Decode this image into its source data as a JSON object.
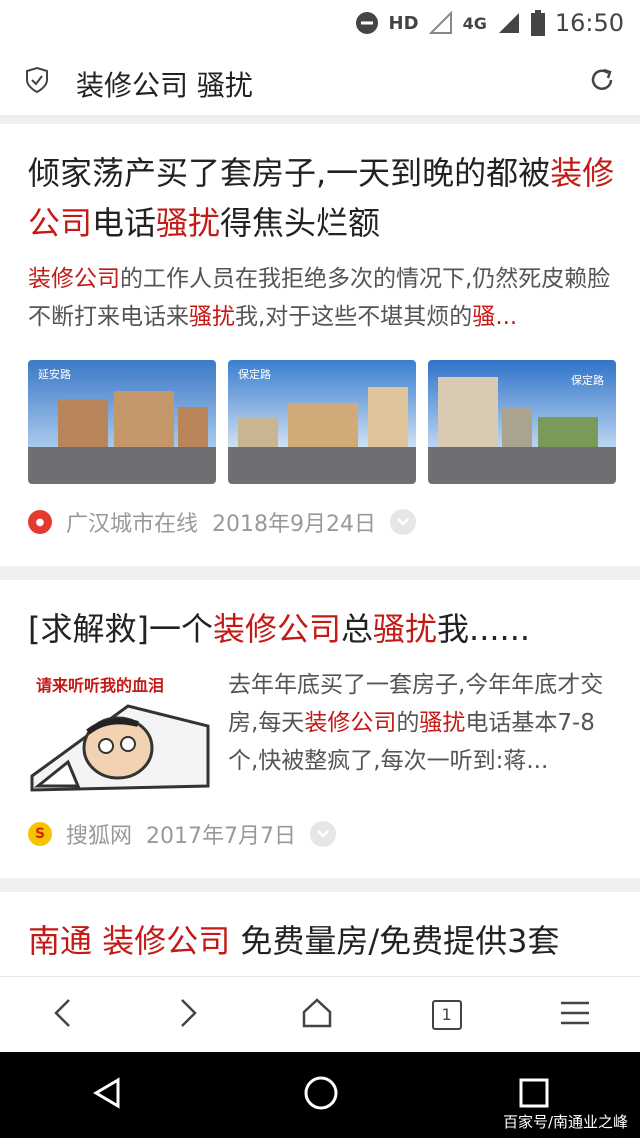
{
  "status_bar": {
    "network_hd": "HD",
    "network_4g": "4G",
    "time": "16:50"
  },
  "search": {
    "query": "装修公司 骚扰"
  },
  "results": [
    {
      "title_parts": [
        {
          "text": "倾家荡产买了套房子,一天到晚的都被",
          "hl": false
        },
        {
          "text": "装修公司",
          "hl": true
        },
        {
          "text": "电话",
          "hl": false
        },
        {
          "text": "骚扰",
          "hl": true
        },
        {
          "text": "得焦头烂额",
          "hl": false
        }
      ],
      "snippet_parts": [
        {
          "text": "装修公司",
          "hl": true
        },
        {
          "text": "的工作人员在我拒绝多次的情况下,仍然死皮赖脸不断打来电话来",
          "hl": false
        },
        {
          "text": "骚扰",
          "hl": true
        },
        {
          "text": "我,对于这些不堪其烦的",
          "hl": false
        },
        {
          "text": "骚...",
          "hl": true
        }
      ],
      "image_captions": [
        "延安路",
        "保定路",
        "保定路"
      ],
      "source": "广汉城市在线",
      "date": "2018年9月24日"
    },
    {
      "title_parts": [
        {
          "text": "[求解救]一个",
          "hl": false
        },
        {
          "text": "装修公司",
          "hl": true
        },
        {
          "text": "总",
          "hl": false
        },
        {
          "text": "骚扰",
          "hl": true
        },
        {
          "text": "我......",
          "hl": false
        }
      ],
      "cartoon_caption": "请来听听我的血泪",
      "snippet_parts": [
        {
          "text": "去年年底买了一套房子,今年年底才交房,每天",
          "hl": false
        },
        {
          "text": "装修公司",
          "hl": true
        },
        {
          "text": "的",
          "hl": false
        },
        {
          "text": "骚扰",
          "hl": true
        },
        {
          "text": "电话基本7-8个,快被整疯了,每次一听到:蒋...",
          "hl": false
        }
      ],
      "source": "搜狐网",
      "date": "2017年7月7日"
    },
    {
      "title_parts": [
        {
          "text": "南通",
          "hl": true
        },
        {
          "text": " ",
          "hl": false
        },
        {
          "text": "装修公司",
          "hl": true
        },
        {
          "text": " 免费量房/免费提供3套",
          "hl": false
        }
      ]
    }
  ],
  "bottom_nav": {
    "tab_count": "1"
  },
  "watermark": "百家号/南通业之峰"
}
